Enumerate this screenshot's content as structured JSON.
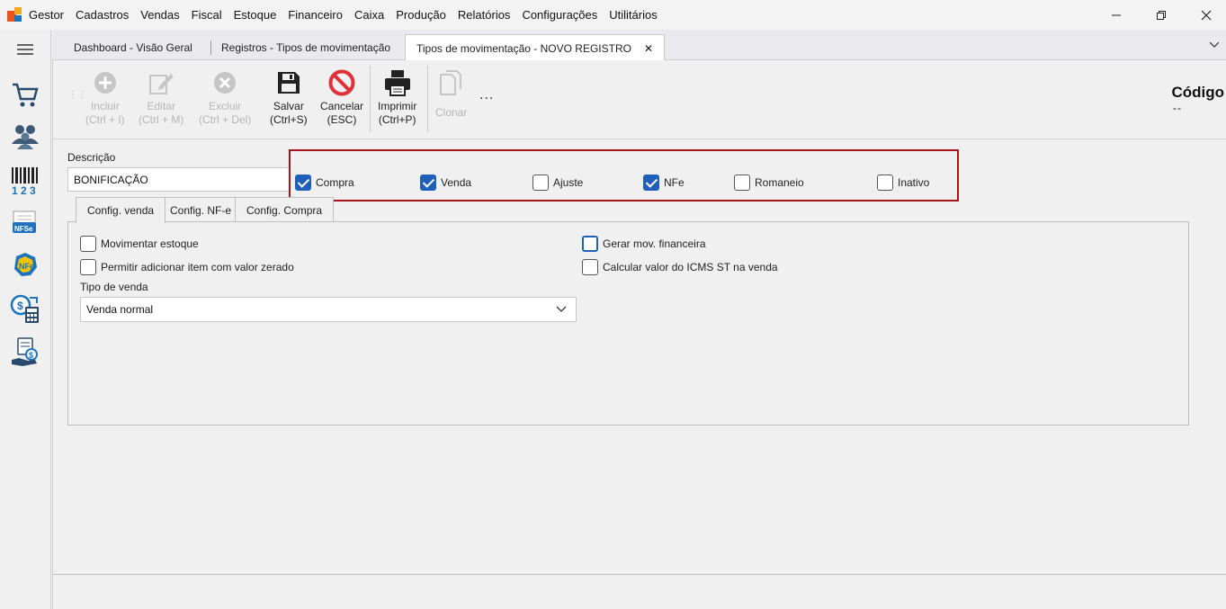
{
  "menubar": {
    "items": [
      "Gestor",
      "Cadastros",
      "Vendas",
      "Fiscal",
      "Estoque",
      "Financeiro",
      "Caixa",
      "Produção",
      "Relatórios",
      "Configurações",
      "Utilitários"
    ],
    "window_controls": {
      "minimize": "—",
      "restore": "❐",
      "close": "✕"
    }
  },
  "sidebar": {
    "icons": [
      "menu-icon",
      "cart-icon",
      "users-icon",
      "barcode-icon",
      "nfse-icon",
      "nfe-icon",
      "finance-calculator-icon",
      "cash-hand-icon"
    ]
  },
  "doc_tabs": [
    {
      "label": "Dashboard - Visão Geral",
      "active": false
    },
    {
      "label": "Registros - Tipos de movimentação",
      "active": false
    },
    {
      "label": "Tipos de movimentação - NOVO REGISTRO",
      "active": true,
      "close": "✕"
    }
  ],
  "toolbar": {
    "incluir": {
      "label": "Incluir",
      "shortcut": "(Ctrl + I)"
    },
    "editar": {
      "label": "Editar",
      "shortcut": "(Ctrl + M)"
    },
    "excluir": {
      "label": "Excluir",
      "shortcut": "(Ctrl + Del)"
    },
    "salvar": {
      "label": "Salvar",
      "shortcut": "(Ctrl+S)"
    },
    "cancelar": {
      "label": "Cancelar",
      "shortcut": "(ESC)"
    },
    "imprimir": {
      "label": "Imprimir",
      "shortcut": "(Ctrl+P)"
    },
    "clonar": {
      "label": "Clonar"
    },
    "more": "..."
  },
  "codigo": {
    "label": "Código",
    "value": "--"
  },
  "form": {
    "descricao_label": "Descrição",
    "descricao_value": "BONIFICAÇÃO",
    "type_flags": [
      {
        "label": "Compra",
        "checked": true
      },
      {
        "label": "Venda",
        "checked": true
      },
      {
        "label": "Ajuste",
        "checked": false
      },
      {
        "label": "NFe",
        "checked": true
      },
      {
        "label": "Romaneio",
        "checked": false
      },
      {
        "label": "Inativo",
        "checked": false
      }
    ]
  },
  "inner_tabs": [
    "Config. venda",
    "Config. NF-e",
    "Config. Compra"
  ],
  "config_venda": {
    "movimentar_estoque": {
      "label": "Movimentar estoque",
      "checked": false
    },
    "permitir_zerado": {
      "label": "Permitir adicionar item com valor zerado",
      "checked": false
    },
    "gerar_mov_financeira": {
      "label": "Gerar mov. financeira",
      "checked": false
    },
    "calcular_icms_st": {
      "label": "Calcular valor do ICMS ST na venda",
      "checked": false
    },
    "tipo_venda_label": "Tipo de venda",
    "tipo_venda_value": "Venda normal"
  },
  "colors": {
    "accent": "#1f5fba",
    "highlight_border": "#a4141a",
    "cancel_red": "#e0303a"
  }
}
